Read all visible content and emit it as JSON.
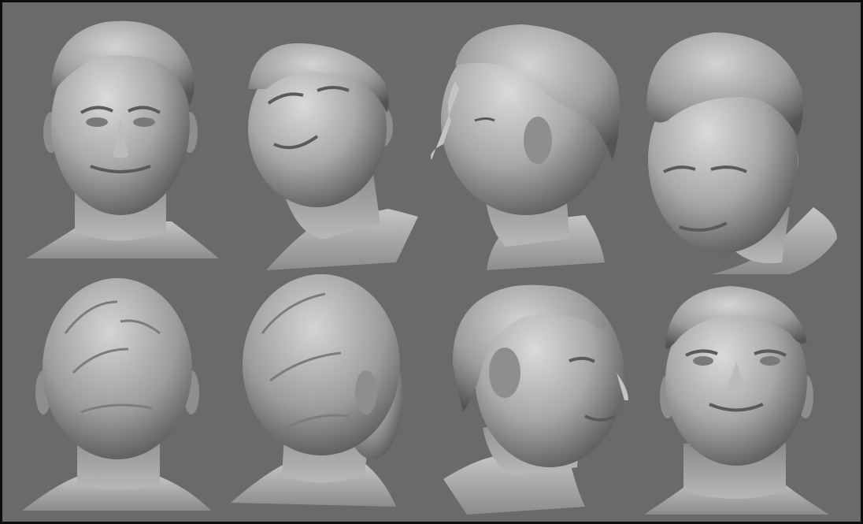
{
  "image": {
    "subject": "head-sculpt-turnaround",
    "views": [
      {
        "label": "front"
      },
      {
        "label": "low-angle-three-quarter-left"
      },
      {
        "label": "profile-left"
      },
      {
        "label": "high-angle-three-quarter-right"
      },
      {
        "label": "back"
      },
      {
        "label": "back-three-quarter-right"
      },
      {
        "label": "three-quarter-right-smile"
      },
      {
        "label": "low-angle-front"
      }
    ],
    "colors": {
      "background": "#6a6a6a",
      "border": "#0d0d0d",
      "clay_light": "#d2d2d2",
      "clay_mid": "#9a9a9a",
      "clay_dark": "#4e4e4e"
    }
  }
}
